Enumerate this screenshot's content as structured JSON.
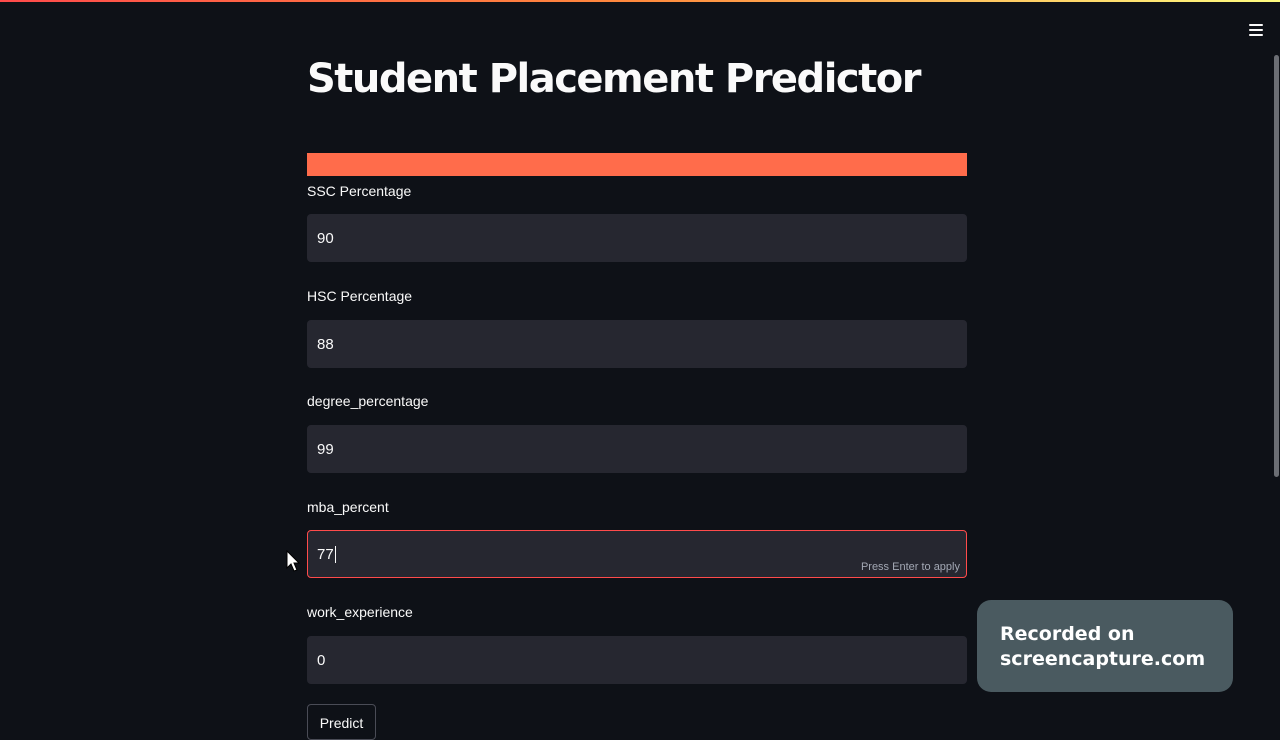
{
  "app": {
    "title": "Student Placement Predictor",
    "menu_icon": "hamburger-menu-icon"
  },
  "progress": {
    "value_percent": 100,
    "color": "#ff6c4b"
  },
  "fields": [
    {
      "label": "SSC Percentage",
      "value": "90"
    },
    {
      "label": "HSC Percentage",
      "value": "88"
    },
    {
      "label": "degree_percentage",
      "value": "99"
    },
    {
      "label": "mba_percent",
      "value": "77",
      "hint": "Press Enter to apply"
    },
    {
      "label": "work_experience",
      "value": "0"
    }
  ],
  "predict_button": {
    "label": "Predict"
  },
  "recorder": {
    "line1": "Recorded on",
    "line2": "screencapture.com"
  },
  "colors": {
    "background": "#0e1117",
    "input_background": "#262730",
    "focus_border": "#ff4b4b",
    "accent": "#ff6c4b"
  }
}
